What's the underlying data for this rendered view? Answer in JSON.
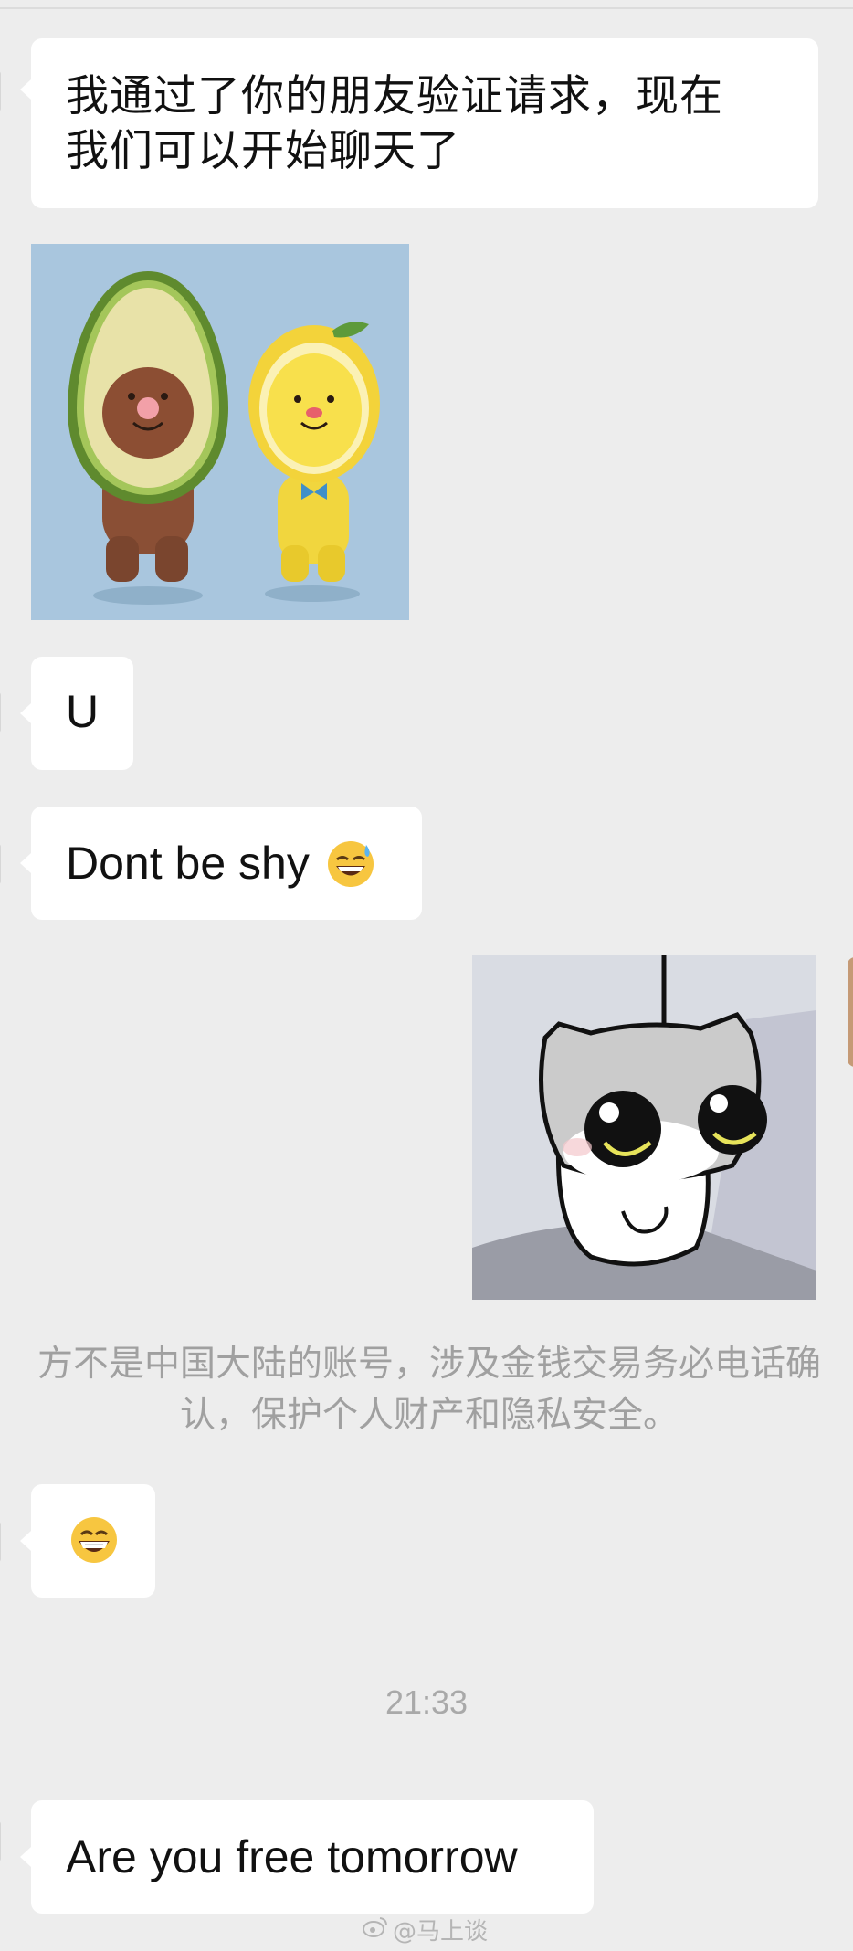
{
  "messages": {
    "greeting": {
      "line1": "我通过了你的朋友验证请求，现在",
      "line2": "我们可以开始聊天了"
    },
    "u_message": "U",
    "dont_be_shy": "Dont be shy",
    "dont_be_shy_emoji": "grinning-sweat-emoji",
    "grin_emoji": "grinning-face-emoji",
    "are_you_free": "Are you free tomorrow"
  },
  "stickers": {
    "avocado_lemon": "avocado-and-lemon-figurines-sticker",
    "cat": "gray-cat-hanging-sticker"
  },
  "system_notice": {
    "line1": "方不是中国大陆的账号，涉及金钱交易务必电话确",
    "line2": "认，保护个人财产和隐私安全。"
  },
  "timestamp": "21:33",
  "watermark": {
    "icon": "weibo-icon",
    "text": "@马上谈"
  },
  "colors": {
    "background": "#ededed",
    "bubble": "#ffffff",
    "notice_text": "#a0a0a0",
    "sticker_blue": "#a9c6de",
    "cat_bg": "#d9dce3"
  }
}
